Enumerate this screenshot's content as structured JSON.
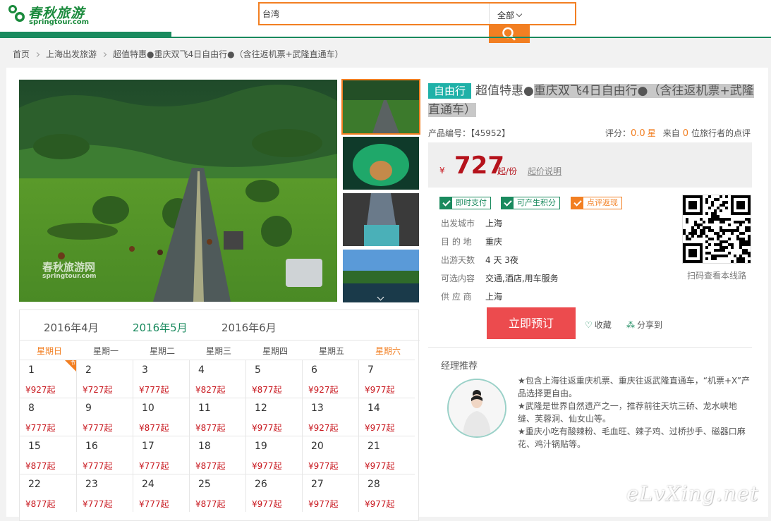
{
  "logo": {
    "name_cn": "春秋旅游",
    "name_en": "springtour.com"
  },
  "search": {
    "value": "台湾",
    "category": "全部",
    "icon": "search-icon"
  },
  "breadcrumb": [
    "首页",
    "上海出发旅游",
    "超值特惠●重庆双飞4日自由行●（含往返机票+武隆直通车）"
  ],
  "product": {
    "badge": "自由行",
    "title_main": "超值特惠●",
    "title_highlight": "重庆双飞4日自由行●（含往返机票+武隆直通车）",
    "code_label": "产品编号：【45952】",
    "rating_label": "评分：",
    "rating_value": "0.0",
    "rating_unit": "星",
    "reviews_prefix": "来自",
    "reviews_count": "0",
    "reviews_suffix": "位旅行者的点评"
  },
  "price": {
    "currency": "¥",
    "amount": "727",
    "unit": "起/份",
    "note": "起价说明"
  },
  "tags": [
    "即时支付",
    "可产生积分",
    "点评返现"
  ],
  "details": [
    {
      "k": "出发城市",
      "v": "上海"
    },
    {
      "k": "目 的 地",
      "v": "重庆"
    },
    {
      "k": "出游天数",
      "v": "4 天 3夜"
    },
    {
      "k": "可选内容",
      "v": "交通,酒店,用车服务"
    },
    {
      "k": "供 应 商",
      "v": "上海"
    }
  ],
  "qr_caption": "扫码查看本线路",
  "actions": {
    "book": "立即预订",
    "favorite": "收藏",
    "share": "分享到"
  },
  "manager": {
    "label": "经理推荐",
    "lines": [
      "★包含上海往返重庆机票、重庆往返武隆直通车，“机票+X”产品选择更自由。",
      "★武隆是世界自然遗产之一，推荐前往天坑三硚、龙水峡地缝、芙蓉洞、仙女山等。",
      "★重庆小吃有酸辣粉、毛血旺、辣子鸡、过桥抄手、磁器口麻花、鸡汁锅贴等。"
    ]
  },
  "calendar": {
    "months": [
      "2016年4月",
      "2016年5月",
      "2016年6月"
    ],
    "active_month": "2016年5月",
    "weekdays": [
      "星期日",
      "星期一",
      "星期二",
      "星期三",
      "星期四",
      "星期五",
      "星期六"
    ],
    "holiday_tag": "节",
    "days": [
      {
        "d": "1",
        "p": "¥927起"
      },
      {
        "d": "2",
        "p": "¥727起"
      },
      {
        "d": "3",
        "p": "¥777起"
      },
      {
        "d": "4",
        "p": "¥827起"
      },
      {
        "d": "5",
        "p": "¥877起"
      },
      {
        "d": "6",
        "p": "¥927起"
      },
      {
        "d": "7",
        "p": "¥977起"
      },
      {
        "d": "8",
        "p": "¥777起"
      },
      {
        "d": "9",
        "p": "¥777起"
      },
      {
        "d": "10",
        "p": "¥877起"
      },
      {
        "d": "11",
        "p": "¥877起"
      },
      {
        "d": "12",
        "p": "¥977起"
      },
      {
        "d": "13",
        "p": "¥927起"
      },
      {
        "d": "14",
        "p": "¥977起"
      },
      {
        "d": "15",
        "p": "¥877起"
      },
      {
        "d": "16",
        "p": "¥777起"
      },
      {
        "d": "17",
        "p": "¥777起"
      },
      {
        "d": "18",
        "p": "¥877起"
      },
      {
        "d": "19",
        "p": "¥977起"
      },
      {
        "d": "20",
        "p": "¥977起"
      },
      {
        "d": "21",
        "p": "¥977起"
      },
      {
        "d": "22",
        "p": "¥877起"
      },
      {
        "d": "23",
        "p": "¥777起"
      },
      {
        "d": "24",
        "p": "¥777起"
      },
      {
        "d": "25",
        "p": "¥877起"
      },
      {
        "d": "26",
        "p": "¥977起"
      },
      {
        "d": "27",
        "p": "¥977起"
      },
      {
        "d": "28",
        "p": "¥977起"
      }
    ]
  },
  "image_watermark": {
    "cn": "春秋旅游网",
    "en": "springtour.com"
  },
  "site_watermark": "eLvXing.net",
  "colors": {
    "brand_green": "#1a8a5e",
    "accent_orange": "#f27f22",
    "price_red": "#b5121b",
    "book_red": "#ec4b4e",
    "badge_teal": "#1fb1a8"
  }
}
